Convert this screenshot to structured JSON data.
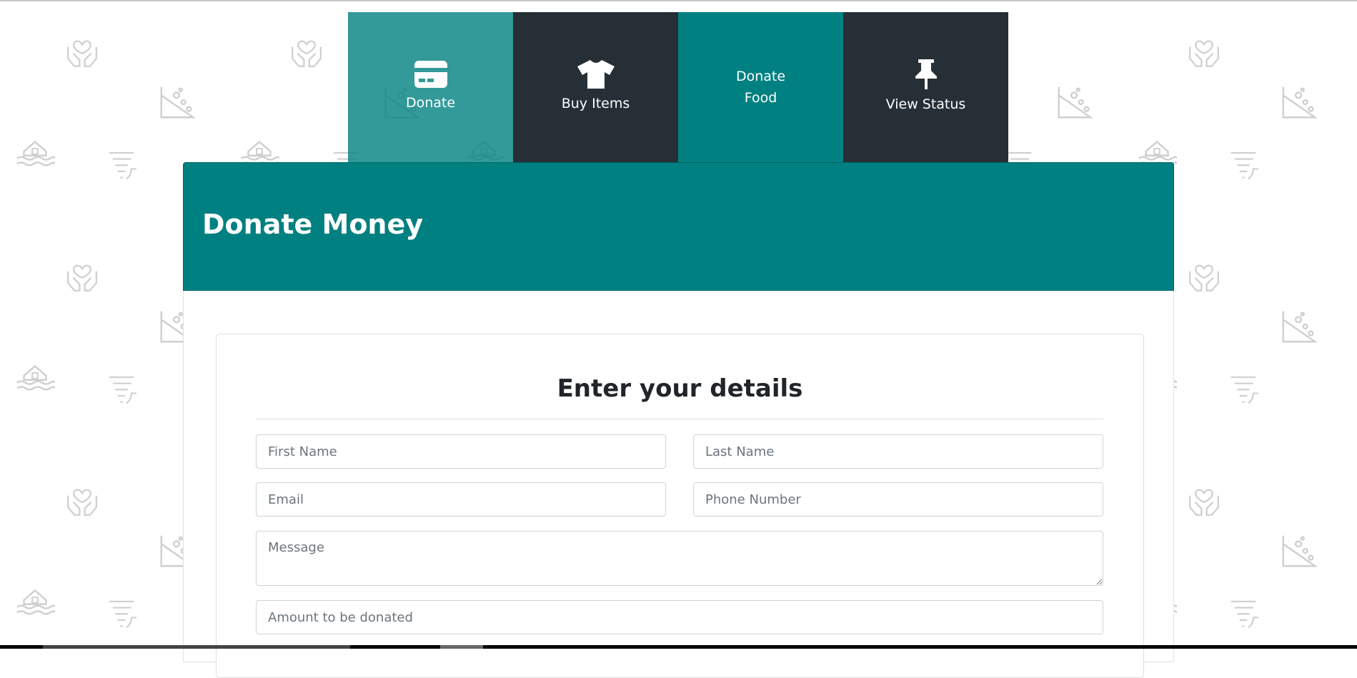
{
  "nav": {
    "tabs": [
      {
        "label": "Donate",
        "icon": "credit-card-icon"
      },
      {
        "label": "Buy Items",
        "icon": "t-shirt-icon"
      },
      {
        "label": "Donate Food",
        "icon": ""
      },
      {
        "label": "View Status",
        "icon": "pushpin-icon"
      }
    ]
  },
  "header": {
    "title": "Donate Money"
  },
  "form": {
    "title": "Enter your details",
    "first_name_placeholder": "First Name",
    "last_name_placeholder": "Last Name",
    "email_placeholder": "Email",
    "phone_placeholder": "Phone Number",
    "message_placeholder": "Message",
    "amount_placeholder": "Amount to be donated"
  },
  "colors": {
    "teal": "#008080",
    "dark": "#262f36",
    "pattern": "#d0d0d0"
  },
  "background": {
    "pattern_icons": [
      "hands-heart-icon",
      "landslide-icon",
      "flood-house-icon",
      "tornado-icon"
    ]
  }
}
